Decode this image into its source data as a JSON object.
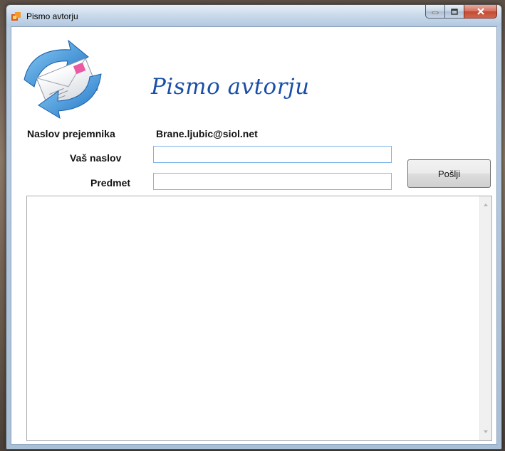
{
  "window": {
    "title": "Pismo avtorju"
  },
  "header": {
    "title": "Pismo avtorju"
  },
  "form": {
    "recipient_label": "Naslov prejemnika",
    "recipient_value": "Brane.ljubic@siol.net",
    "your_address_label": "Vaš naslov",
    "your_address_value": "",
    "subject_label": "Predmet",
    "subject_value": "",
    "message_value": ""
  },
  "actions": {
    "send_label": "Pošlji"
  },
  "icons": {
    "app": "mail-app-icon",
    "header": "mail-envelope-arrows-icon",
    "minimize": "minimize-icon",
    "maximize": "maximize-icon",
    "close": "close-icon",
    "scroll_up": "chevron-up-icon",
    "scroll_down": "chevron-down-icon"
  },
  "colors": {
    "title_accent": "#1a4fa8",
    "close_button": "#c24a32"
  }
}
